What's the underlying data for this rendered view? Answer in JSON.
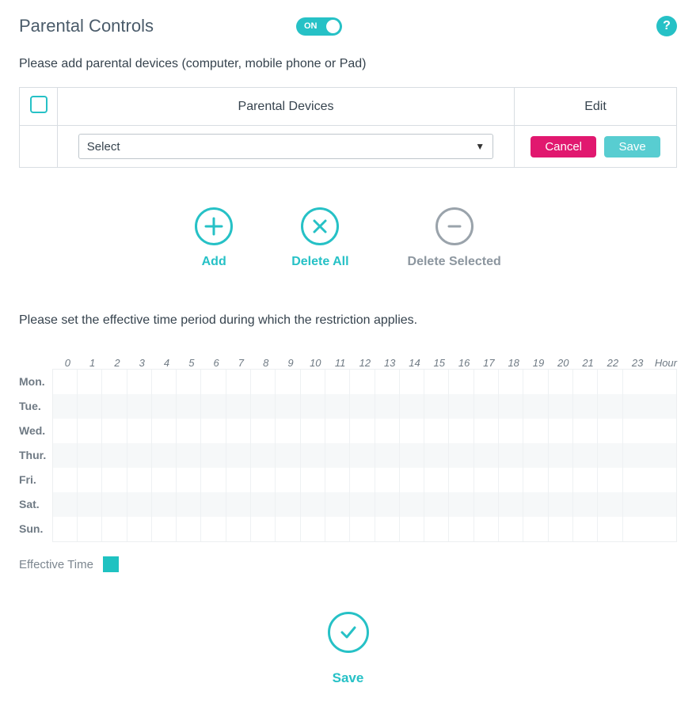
{
  "header": {
    "title": "Parental Controls",
    "toggle_state": "on",
    "toggle_label": "ON",
    "help_glyph": "?"
  },
  "device_prompt": "Please add parental devices (computer, mobile phone or Pad)",
  "table": {
    "col_devices": "Parental Devices",
    "col_edit": "Edit",
    "select_placeholder": "Select",
    "cancel_label": "Cancel",
    "save_label": "Save"
  },
  "actions": {
    "add": "Add",
    "delete_all": "Delete All",
    "delete_selected": "Delete Selected"
  },
  "schedule_prompt": "Please set the effective time period during which the restriction applies.",
  "hours": [
    "0",
    "1",
    "2",
    "3",
    "4",
    "5",
    "6",
    "7",
    "8",
    "9",
    "10",
    "11",
    "12",
    "13",
    "14",
    "15",
    "16",
    "17",
    "18",
    "19",
    "20",
    "21",
    "22",
    "23"
  ],
  "hour_label": "Hour",
  "days": [
    "Mon.",
    "Tue.",
    "Wed.",
    "Thur.",
    "Fri.",
    "Sat.",
    "Sun."
  ],
  "legend_label": "Effective Time",
  "footer_save": "Save",
  "colors": {
    "accent": "#26c1c6",
    "danger": "#e1186f",
    "muted": "#9aa3ab"
  }
}
